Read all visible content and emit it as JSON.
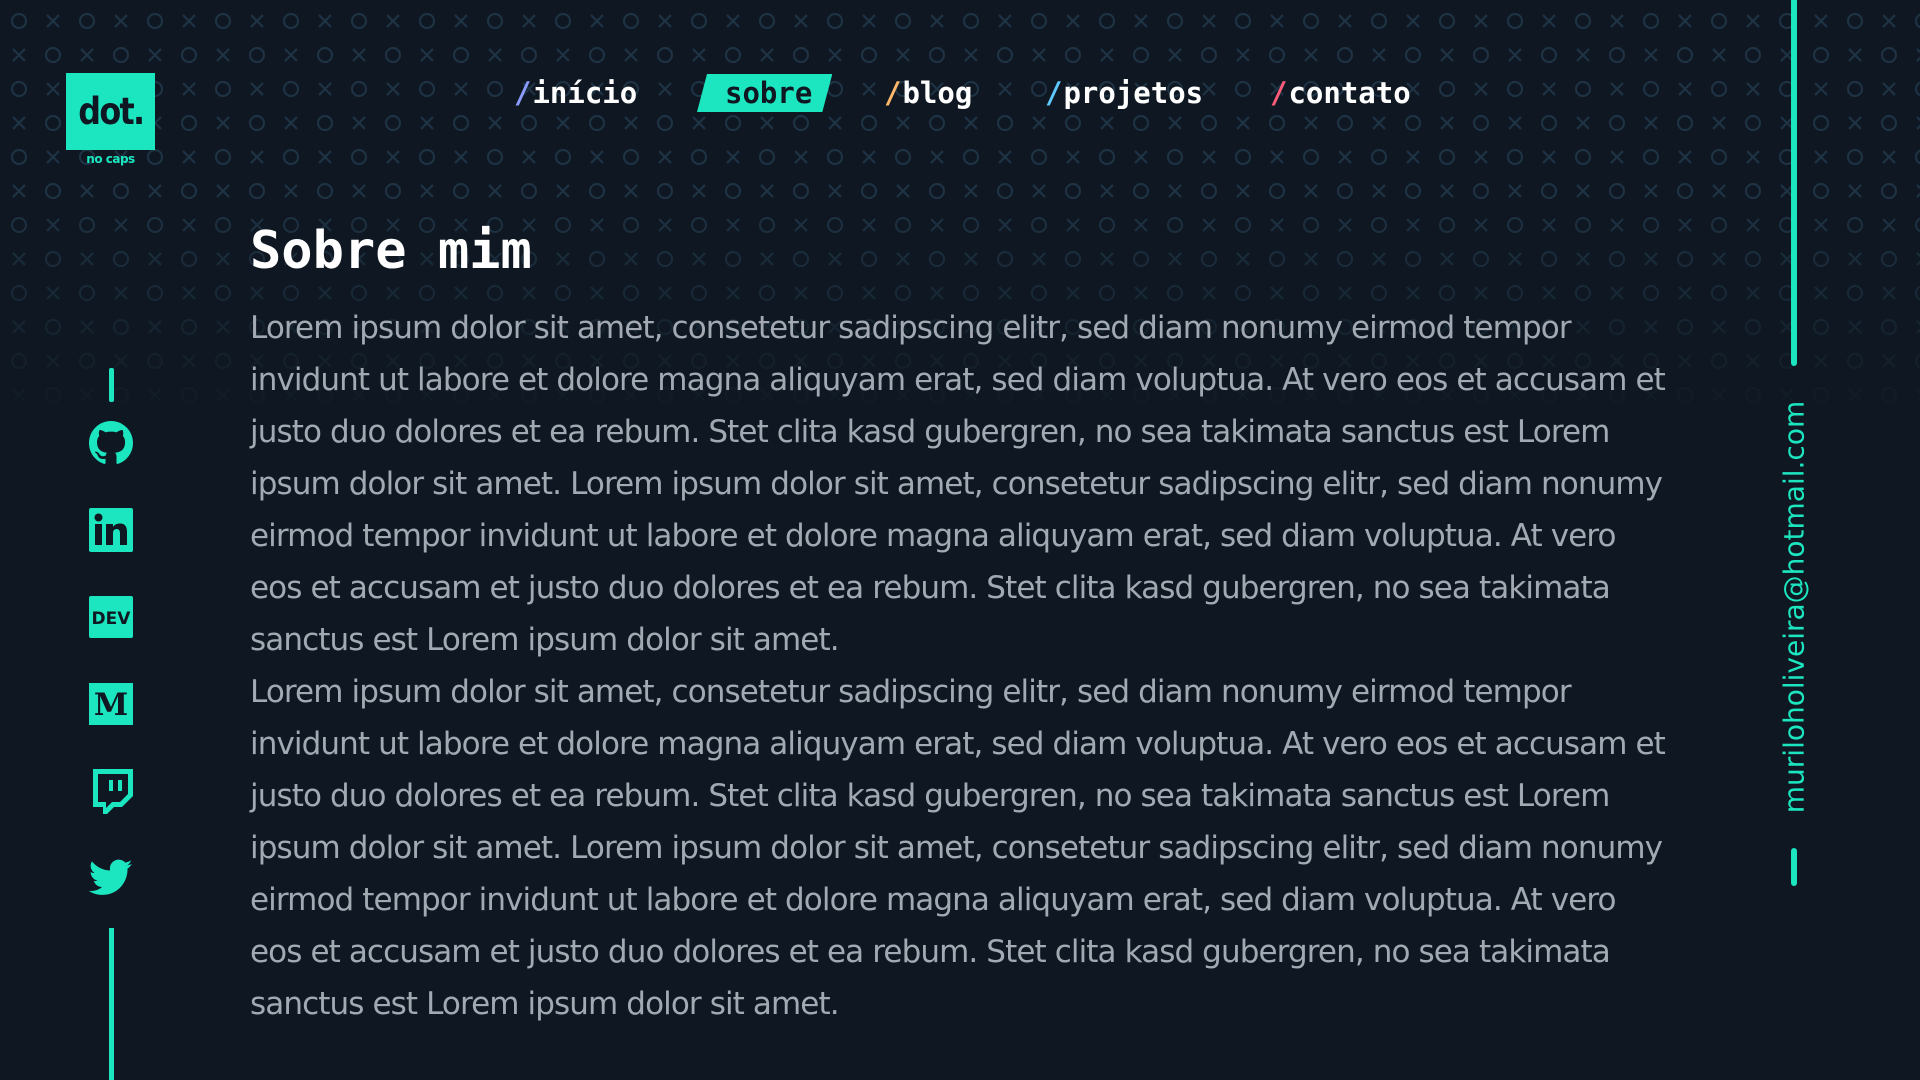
{
  "logo": {
    "text": "dot.",
    "subtitle": "no caps"
  },
  "nav": {
    "items": [
      {
        "slash": "/",
        "label": "início",
        "slash_color": "#8b9cff",
        "active": false
      },
      {
        "slash": "/",
        "label": "sobre",
        "slash_color": "#1ce6c0",
        "active": true
      },
      {
        "slash": "/",
        "label": "blog",
        "slash_color": "#ffb86b",
        "active": false
      },
      {
        "slash": "/",
        "label": "projetos",
        "slash_color": "#5ec8ff",
        "active": false
      },
      {
        "slash": "/",
        "label": "contato",
        "slash_color": "#ff5c7a",
        "active": false
      }
    ]
  },
  "social": {
    "icons": [
      "github-icon",
      "linkedin-icon",
      "dev-icon",
      "medium-icon",
      "twitch-icon",
      "twitter-icon"
    ],
    "dev_label": "DEV",
    "medium_label": "M"
  },
  "main": {
    "title": "Sobre mim",
    "paragraphs": [
      "Lorem ipsum dolor sit amet, consetetur sadipscing elitr, sed diam nonumy eirmod tempor invidunt ut labore et dolore magna aliquyam erat, sed diam voluptua. At vero eos et accusam et justo duo dolores et ea rebum. Stet clita kasd gubergren, no sea takimata sanctus est Lorem ipsum dolor sit amet. Lorem ipsum dolor sit amet, consetetur sadipscing elitr, sed diam nonumy eirmod tempor invidunt ut labore et dolore magna aliquyam erat, sed diam voluptua. At vero eos et accusam et justo duo dolores et ea rebum. Stet clita kasd gubergren, no sea takimata sanctus est Lorem ipsum dolor sit amet.",
      "Lorem ipsum dolor sit amet, consetetur sadipscing elitr, sed diam nonumy eirmod tempor invidunt ut labore et dolore magna aliquyam erat, sed diam voluptua. At vero eos et accusam et justo duo dolores et ea rebum. Stet clita kasd gubergren, no sea takimata sanctus est Lorem ipsum dolor sit amet. Lorem ipsum dolor sit amet, consetetur sadipscing elitr, sed diam nonumy eirmod tempor invidunt ut labore et dolore magna aliquyam erat, sed diam voluptua. At vero eos et accusam et justo duo dolores et ea rebum. Stet clita kasd gubergren, no sea takimata sanctus est Lorem ipsum dolor sit amet."
    ]
  },
  "contact": {
    "email": "muriloholiveira@hotmail.com"
  },
  "colors": {
    "accent": "#1ce6c0",
    "background": "#0f1822",
    "text_muted": "#a2a9b2",
    "pattern": "#1e3446"
  }
}
